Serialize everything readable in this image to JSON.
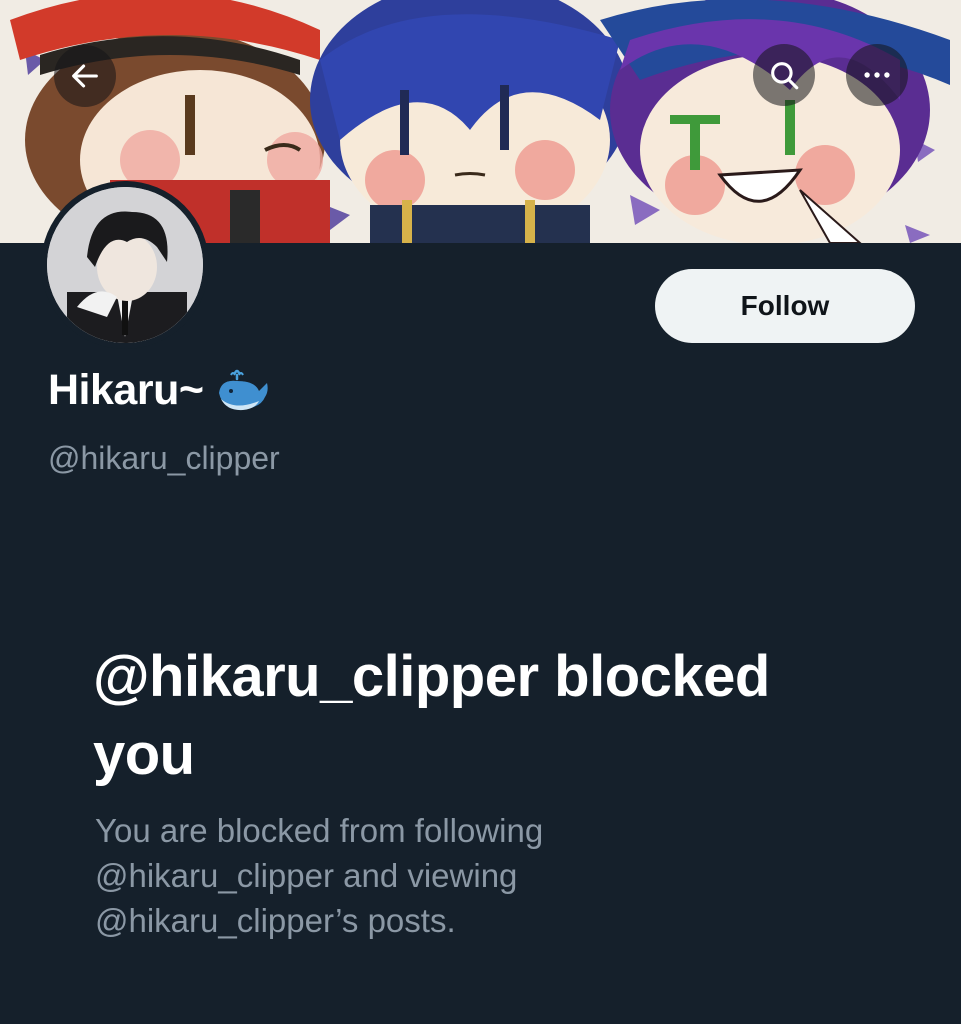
{
  "profile": {
    "display_name": "Hikaru~",
    "name_emoji_icon": "whale-emoji-icon",
    "handle": "@hikaru_clipper"
  },
  "actions": {
    "follow_label": "Follow"
  },
  "nav": {
    "back_icon": "arrow-left-icon",
    "search_icon": "search-icon",
    "more_icon": "more-horizontal-icon"
  },
  "blocked": {
    "title": "@hikaru_clipper blocked you",
    "description": "You are blocked from following @hikaru_clipper and viewing @hikaru_clipper’s posts."
  },
  "colors": {
    "background": "#15202b",
    "primary_text": "#ffffff",
    "secondary_text": "#8b98a5",
    "follow_button_bg": "#eff3f4"
  }
}
